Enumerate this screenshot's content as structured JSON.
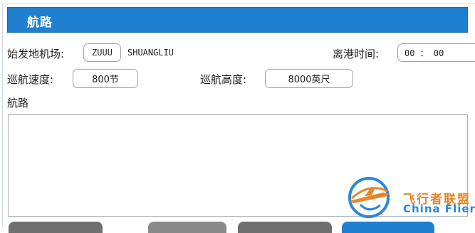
{
  "header": {
    "title": "航路"
  },
  "form": {
    "departure_label": "始发地机场:",
    "departure_code": "ZUUU",
    "departure_name": "SHUANGLIU",
    "departure_time_label": "离港时间:",
    "departure_time_value": "00 ： 00",
    "speed_label": "巡航速度:",
    "speed_value": "800节",
    "altitude_label": "巡航高度:",
    "altitude_value": "8000英尺",
    "route_label": "航路",
    "route_value": ""
  },
  "watermark": {
    "brand_cn": "飞行者联盟",
    "brand_en": "China Flier"
  },
  "colors": {
    "header_bg": "#1f7fd0",
    "watermark_orange": "#e88524",
    "watermark_blue": "#2b87d8",
    "button_gray": "#6f6f6f"
  }
}
